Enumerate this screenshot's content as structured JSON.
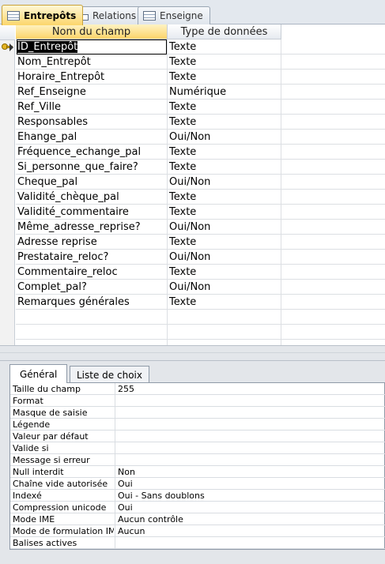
{
  "tabs": [
    {
      "label": "Entrepôts",
      "icon": "table-icon",
      "active": true
    },
    {
      "label": "Relations",
      "icon": "relations-icon",
      "active": false
    },
    {
      "label": "Enseigne",
      "icon": "table-icon",
      "active": false
    }
  ],
  "grid": {
    "col_field": "Nom du champ",
    "col_type": "Type de données",
    "rows": [
      {
        "name": "ID_Entrepôt",
        "type": "Texte"
      },
      {
        "name": "Nom_Entrepôt",
        "type": "Texte"
      },
      {
        "name": "Horaire_Entrepôt",
        "type": "Texte"
      },
      {
        "name": "Ref_Enseigne",
        "type": "Numérique"
      },
      {
        "name": "Ref_Ville",
        "type": "Texte"
      },
      {
        "name": "Responsables",
        "type": "Texte"
      },
      {
        "name": "Ehange_pal",
        "type": "Oui/Non"
      },
      {
        "name": "Fréquence_echange_pal",
        "type": "Texte"
      },
      {
        "name": "Si_personne_que_faire?",
        "type": "Texte"
      },
      {
        "name": "Cheque_pal",
        "type": "Oui/Non"
      },
      {
        "name": "Validité_chèque_pal",
        "type": "Texte"
      },
      {
        "name": "Validité_commentaire",
        "type": "Texte"
      },
      {
        "name": "Même_adresse_reprise?",
        "type": "Oui/Non"
      },
      {
        "name": "Adresse reprise",
        "type": "Texte"
      },
      {
        "name": "Prestataire_reloc?",
        "type": "Oui/Non"
      },
      {
        "name": "Commentaire_reloc",
        "type": "Texte"
      },
      {
        "name": "Complet_pal?",
        "type": "Oui/Non"
      },
      {
        "name": "Remarques générales",
        "type": "Texte"
      }
    ]
  },
  "props": {
    "tabs": [
      "Général",
      "Liste de choix"
    ],
    "rows": [
      {
        "label": "Taille du champ",
        "value": "255"
      },
      {
        "label": "Format",
        "value": ""
      },
      {
        "label": "Masque de saisie",
        "value": ""
      },
      {
        "label": "Légende",
        "value": ""
      },
      {
        "label": "Valeur par défaut",
        "value": ""
      },
      {
        "label": "Valide si",
        "value": ""
      },
      {
        "label": "Message si erreur",
        "value": ""
      },
      {
        "label": "Null interdit",
        "value": "Non"
      },
      {
        "label": "Chaîne vide autorisée",
        "value": "Oui"
      },
      {
        "label": "Indexé",
        "value": "Oui - Sans doublons"
      },
      {
        "label": "Compression unicode",
        "value": "Oui"
      },
      {
        "label": "Mode IME",
        "value": "Aucun contrôle"
      },
      {
        "label": "Mode de formulation IME",
        "value": "Aucun"
      },
      {
        "label": "Balises actives",
        "value": ""
      }
    ]
  }
}
